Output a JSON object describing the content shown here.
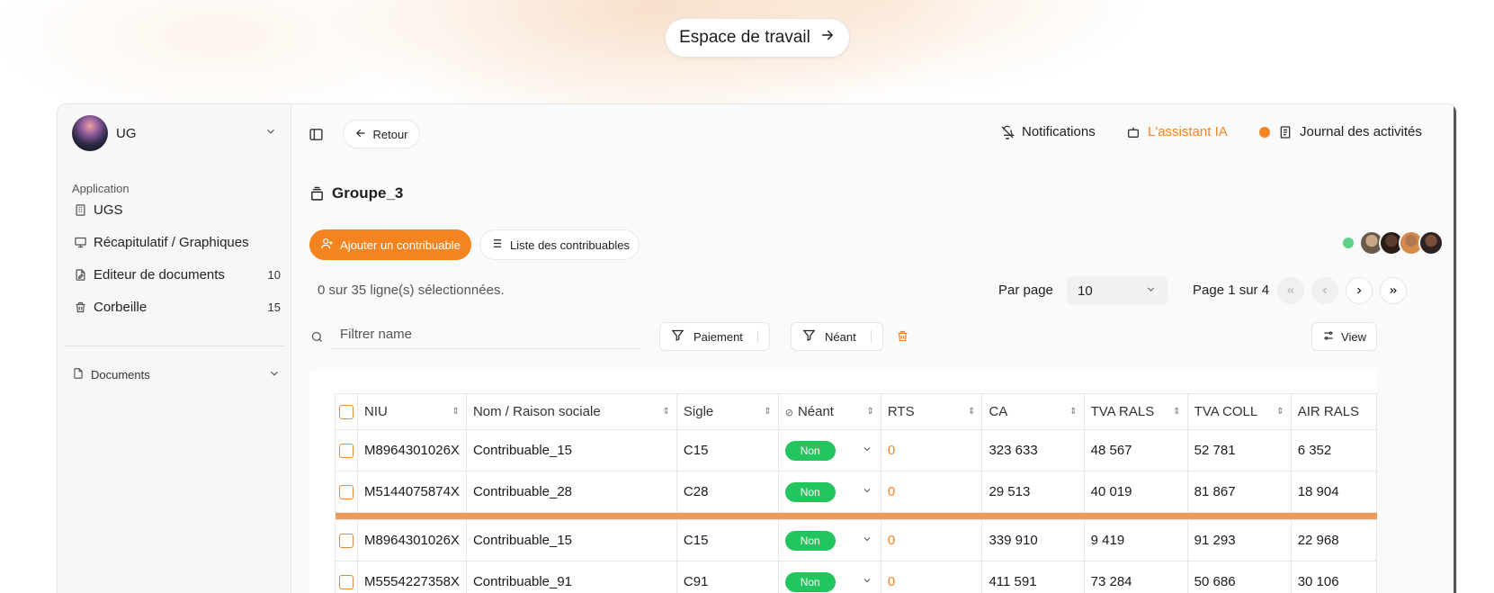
{
  "workspace_button": {
    "label": "Espace de travail"
  },
  "sidebar": {
    "team_name": "UG",
    "section_label": "Application",
    "items": [
      {
        "label": "UGS",
        "icon": "building-icon",
        "count": ""
      },
      {
        "label": "Récapitulatif / Graphiques",
        "icon": "presentation-icon",
        "count": ""
      },
      {
        "label": "Editeur de documents",
        "icon": "file-edit-icon",
        "count": "10"
      },
      {
        "label": "Corbeille",
        "icon": "trash-icon",
        "count": "15"
      }
    ],
    "documents_label": "Documents"
  },
  "header": {
    "back_label": "Retour",
    "notifications_label": "Notifications",
    "assistant_label": "L'assistant IA",
    "journal_label": "Journal des activités",
    "accent_color": "#f5831f"
  },
  "group": {
    "title": "Groupe_3",
    "add_button": "Ajouter un contribuable",
    "list_button": "Liste des contribuables"
  },
  "toolbar": {
    "selection_text": "0 sur 35 ligne(s) sélectionnées.",
    "per_page_label": "Par page",
    "per_page_value": "10",
    "page_info": "Page 1 sur 4",
    "filter_placeholder": "Filtrer name",
    "chip_paiement": "Paiement",
    "chip_neant": "Néant",
    "view_label": "View"
  },
  "table": {
    "columns": [
      "NIU",
      "Nom / Raison sociale",
      "Sigle",
      "Néant",
      "RTS",
      "CA",
      "TVA RALS",
      "TVA COLL",
      "AIR RALS"
    ],
    "rows": [
      {
        "niu": "M8964301026X",
        "nom": "Contribuable_15",
        "sigle": "C15",
        "neant": "Non",
        "rts": "0",
        "ca": "323 633",
        "tva_rals": "48 567",
        "tva_coll": "52 781",
        "air_rals": "6 352"
      },
      {
        "niu": "M5144075874X",
        "nom": "Contribuable_28",
        "sigle": "C28",
        "neant": "Non",
        "rts": "0",
        "ca": "29 513",
        "tva_rals": "40 019",
        "tva_coll": "81 867",
        "air_rals": "18 904"
      },
      {
        "niu": "M8964301026X",
        "nom": "Contribuable_15",
        "sigle": "C15",
        "neant": "Non",
        "rts": "0",
        "ca": "339 910",
        "tva_rals": "9 419",
        "tva_coll": "91 293",
        "air_rals": "22 968"
      },
      {
        "niu": "M5554227358X",
        "nom": "Contribuable_91",
        "sigle": "C91",
        "neant": "Non",
        "rts": "0",
        "ca": "411 591",
        "tva_rals": "73 284",
        "tva_coll": "50 686",
        "air_rals": "30 106"
      }
    ]
  }
}
